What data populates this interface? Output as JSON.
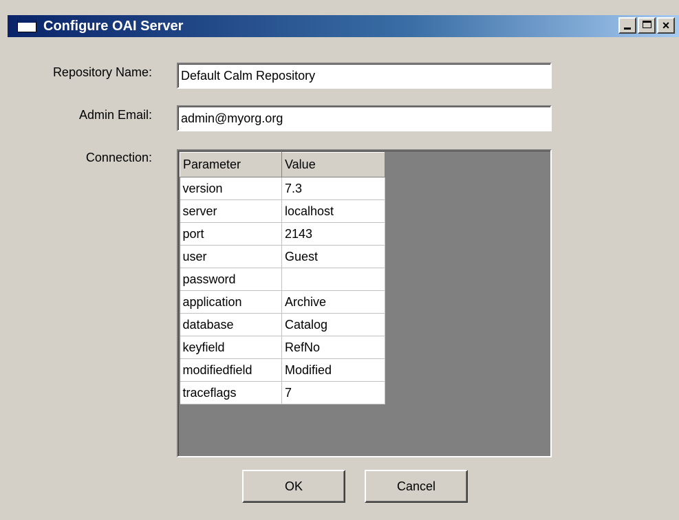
{
  "window": {
    "title": "Configure OAI Server",
    "controls": {
      "minimize": "minimize",
      "maximize": "maximize",
      "close": "×"
    }
  },
  "form": {
    "repository_name_label": "Repository Name:",
    "repository_name_value": "Default Calm Repository",
    "admin_email_label": "Admin Email:",
    "admin_email_value": "admin@myorg.org",
    "connection_label": "Connection:"
  },
  "connection_grid": {
    "columns": [
      "Parameter",
      "Value"
    ],
    "rows": [
      [
        "version",
        "7.3"
      ],
      [
        "server",
        "localhost"
      ],
      [
        "port",
        "2143"
      ],
      [
        "user",
        "Guest"
      ],
      [
        "password",
        ""
      ],
      [
        "application",
        "Archive"
      ],
      [
        "database",
        "Catalog"
      ],
      [
        "keyfield",
        "RefNo"
      ],
      [
        "modifiedfield",
        "Modified"
      ],
      [
        "traceflags",
        "7"
      ]
    ]
  },
  "buttons": {
    "ok_label": "OK",
    "cancel_label": "Cancel"
  },
  "colors": {
    "titlebar_start": "#0a246a",
    "titlebar_end": "#a6caf0",
    "dialog_face": "#d4d0c8",
    "grid_background": "#808080"
  }
}
